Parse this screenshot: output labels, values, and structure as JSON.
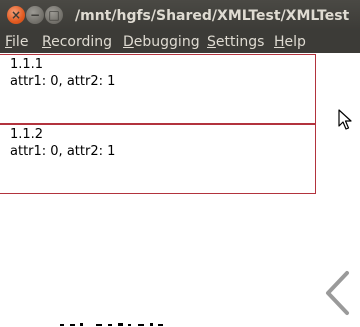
{
  "window": {
    "title": "/mnt/hgfs/Shared/XMLTest/XMLTest",
    "close_glyph": "×",
    "minimize_glyph": "−",
    "maximize_glyph": "□"
  },
  "menubar": {
    "items": [
      {
        "mnemonic": "F",
        "rest": "ile"
      },
      {
        "mnemonic": "R",
        "rest": "ecording"
      },
      {
        "mnemonic": "D",
        "rest": "ebugging"
      },
      {
        "mnemonic": "S",
        "rest": "ettings"
      },
      {
        "mnemonic": "H",
        "rest": "elp"
      }
    ]
  },
  "items": [
    {
      "id": "1.1.1",
      "attrs": "attr1: 0, attr2: 1"
    },
    {
      "id": "1.1.2",
      "attrs": "attr1: 0, attr2: 1"
    }
  ],
  "colors": {
    "titlebar": "#3c3b37",
    "menu_text": "#dfdbd2",
    "item_border": "#b2333d",
    "close_button": "#e25a20"
  },
  "icons": [
    "mouse-pointer-icon",
    "chevron-left-icon"
  ]
}
